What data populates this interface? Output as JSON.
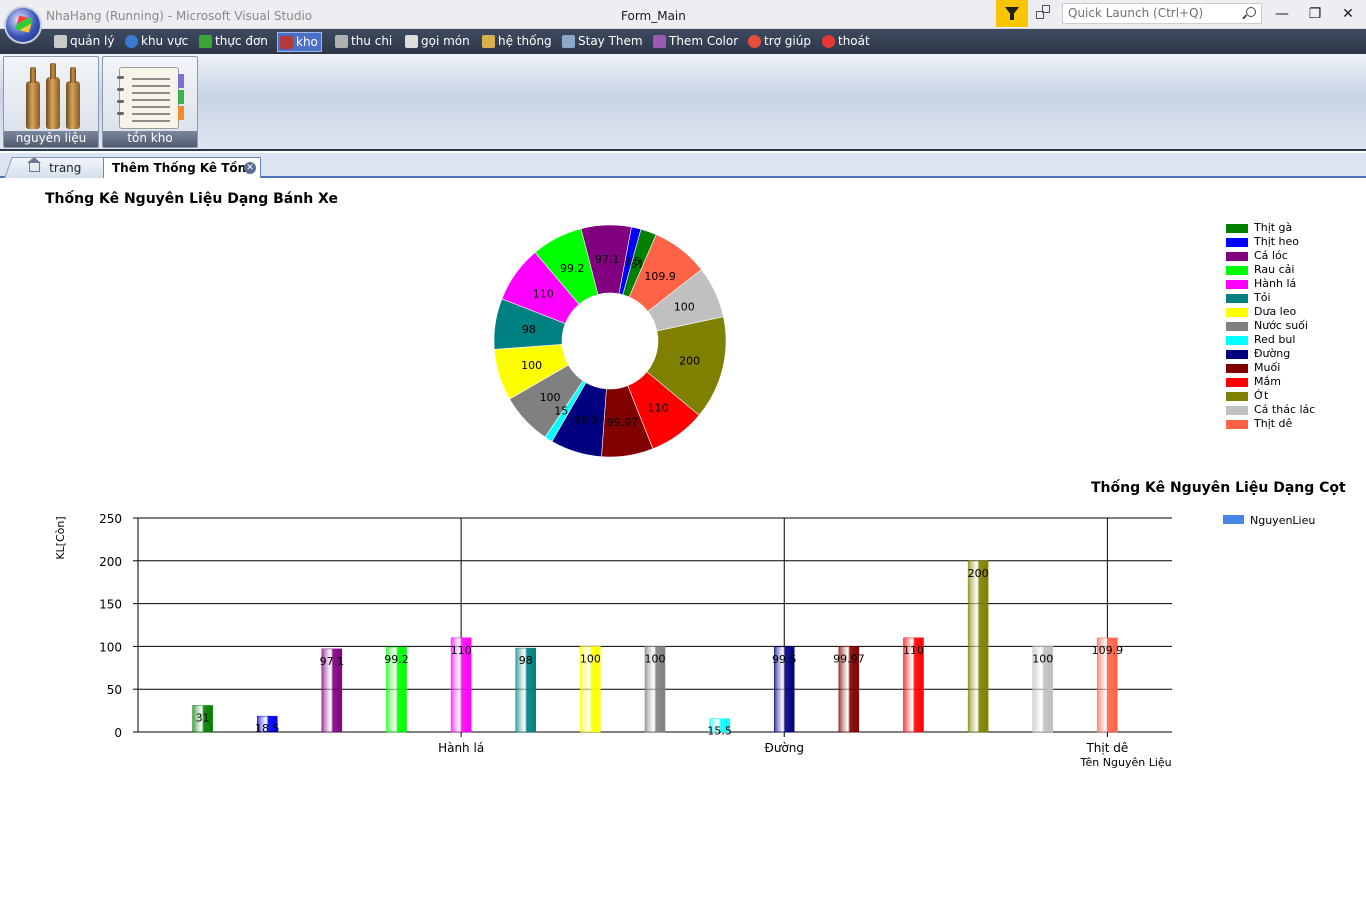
{
  "titlebar": {
    "title": "NhaHang (Running) - Microsoft Visual Studio",
    "form_title": "Form_Main",
    "quick_launch_placeholder": "Quick Launch (Ctrl+Q)",
    "minimize": "—",
    "maximize": "❐",
    "close": "✕"
  },
  "menu": {
    "items": [
      {
        "label": "quản lý",
        "icon": "database-icon",
        "color": "#c9c9c9"
      },
      {
        "label": "khu vực",
        "icon": "globe-icon",
        "color": "#3a7ad4"
      },
      {
        "label": "thực đơn",
        "icon": "menu-book-icon",
        "color": "#3aa63a"
      },
      {
        "label": "kho",
        "icon": "warehouse-icon",
        "color": "#b33a3a"
      },
      {
        "label": "thu chi",
        "icon": "pen-icon",
        "color": "#b0b0b0"
      },
      {
        "label": "gọi món",
        "icon": "phone-icon",
        "color": "#dddddd"
      },
      {
        "label": "hệ thống",
        "icon": "tools-icon",
        "color": "#d6b04c"
      },
      {
        "label": "Stay Them",
        "icon": "stay-icon",
        "color": "#8ca8c8"
      },
      {
        "label": "Them Color",
        "icon": "color-icon",
        "color": "#9b59b6"
      },
      {
        "label": "trợ giúp",
        "icon": "help-icon",
        "color": "#e74c3c"
      },
      {
        "label": "thoát",
        "icon": "exit-icon",
        "color": "#e53935"
      }
    ]
  },
  "ribbon": {
    "buttons": [
      {
        "label": "nguyên liệu",
        "icon": "bottles-icon"
      },
      {
        "label": "tồn kho",
        "icon": "notebook-icon"
      }
    ]
  },
  "tabs": {
    "home": "trang chủ",
    "active": "Thêm Thống Kê Tồn Kho"
  },
  "pie_chart_title": "Thống Kê Nguyên Liệu Dạng Bánh Xe",
  "bar_chart_title": "Thống Kê Nguyên Liệu Dạng Cọt",
  "chart_data": [
    {
      "type": "pie",
      "style": "doughnut",
      "title": "Thống Kê Nguyên Liệu Dạng Bánh Xe",
      "legend_position": "right",
      "categories": [
        "Thịt gà",
        "Thịt heo",
        " Cá lóc",
        "Rau cải",
        "Hành lá",
        "Tỏi",
        "Dưa leo",
        "Nước suối",
        "Red bul",
        "Đường",
        "Muối",
        "Mắm",
        "Ớt",
        "Cá thác lác",
        "Thịt dê"
      ],
      "values": [
        31,
        18.5,
        97.1,
        99.2,
        110,
        98,
        100,
        100,
        15.5,
        99.5,
        99.97,
        110,
        200,
        100,
        109.9
      ],
      "labels": [
        "31",
        "18.5",
        "97.1",
        "99.2",
        "110",
        "98",
        "100",
        "100",
        "15.5",
        "99.5",
        "99.97",
        "110",
        "200",
        "100",
        "109.9"
      ],
      "colors": [
        "#008000",
        "#0000ff",
        "#800080",
        "#00ff00",
        "#ff00ff",
        "#008080",
        "#ffff00",
        "#808080",
        "#00ffff",
        "#000080",
        "#800000",
        "#ff0000",
        "#808000",
        "#c0c0c0",
        "#ff6347"
      ]
    },
    {
      "type": "bar",
      "title": "Thống Kê Nguyên Liệu Dạng Cọt",
      "ylabel": "KL[Còn]",
      "xlabel": "Tên Nguyên Liệu",
      "ylim": [
        0,
        250
      ],
      "yticks": [
        0,
        50,
        100,
        150,
        200,
        250
      ],
      "grid": true,
      "legend_position": "top-right",
      "x_tick_labels": [
        "Hành lá",
        "Đường",
        "Thịt dê"
      ],
      "categories": [
        "Thịt gà",
        "Thịt heo",
        " Cá lóc",
        "Rau cải",
        "Hành lá",
        "Tỏi",
        "Dưa leo",
        "Nước suối",
        "Red bul",
        "Đường",
        "Muối",
        "Mắm",
        "Ớt",
        "Cá thác lác",
        "Thịt dê"
      ],
      "series": [
        {
          "name": "NguyenLieu",
          "color": "#4a86e8",
          "values": [
            31,
            18.5,
            97.1,
            99.2,
            110,
            98,
            100,
            100,
            15.5,
            99.5,
            99.97,
            110,
            200,
            100,
            109.9
          ],
          "labels": [
            "31",
            "18.5",
            "97.1",
            "99.2",
            "110",
            "98",
            "100",
            "100",
            "15.5",
            "99.5",
            "99.97",
            "110",
            "200",
            "100",
            "109.9"
          ]
        }
      ]
    }
  ]
}
